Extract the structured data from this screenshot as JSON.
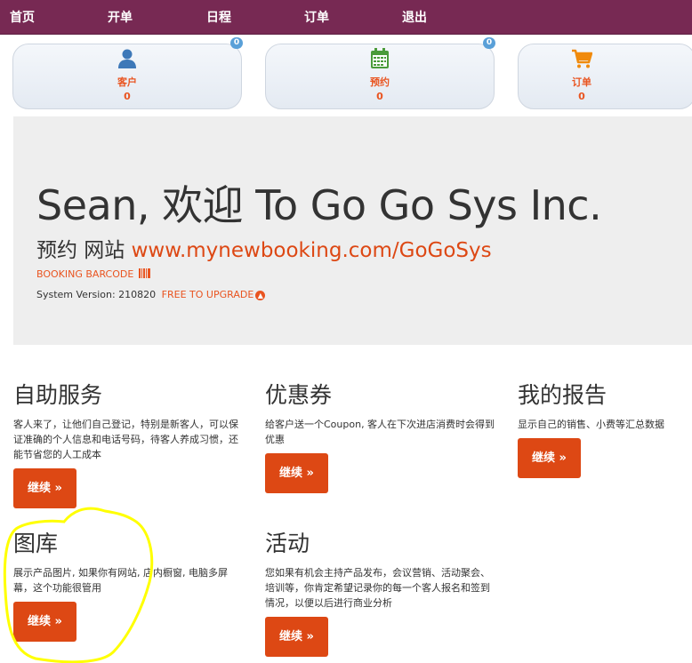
{
  "nav": {
    "items": [
      "首页",
      "开单",
      "日程",
      "订单",
      "退出"
    ]
  },
  "cards": [
    {
      "label": "客户",
      "value": "0",
      "badge": "0",
      "icon": "user-icon"
    },
    {
      "label": "预约",
      "value": "0",
      "badge": "0",
      "icon": "calendar-icon"
    },
    {
      "label": "订单",
      "value": "0",
      "icon": "cart-icon"
    }
  ],
  "hero": {
    "title": "Sean, 欢迎 To Go Go Sys Inc.",
    "site_label": "预约 网站",
    "site_url": "www.mynewbooking.com/GoGoSys",
    "barcode_label": "BOOKING BARCODE",
    "version_label": "System Version: 210820",
    "upgrade_label": "FREE TO UPGRADE"
  },
  "features": [
    {
      "title": "自助服务",
      "desc": "客人来了，让他们自己登记，特别是新客人，可以保证准确的个人信息和电话号码，待客人养成习惯，还能节省您的人工成本",
      "button": "继续 »"
    },
    {
      "title": "优惠券",
      "desc": "给客户送一个Coupon, 客人在下次进店消费时会得到优惠",
      "button": "继续 »"
    },
    {
      "title": "我的报告",
      "desc": "显示自己的销售、小费等汇总数据",
      "button": "继续 »"
    },
    {
      "title": "图库",
      "desc": "展示产品图片, 如果你有网站, 店内橱窗, 电脑多屏幕，这个功能很管用",
      "button": "继续 »"
    },
    {
      "title": "活动",
      "desc": "您如果有机会主持产品发布，会议营销、活动聚会、培训等，你肯定希望记录你的每一个客人报名和签到情况，以便以后进行商业分析",
      "button": "继续 »"
    }
  ],
  "colors": {
    "nav_bg": "#772953",
    "accent": "#dd4814",
    "hero_bg": "#eeeeee",
    "highlight": "#ffff00"
  }
}
